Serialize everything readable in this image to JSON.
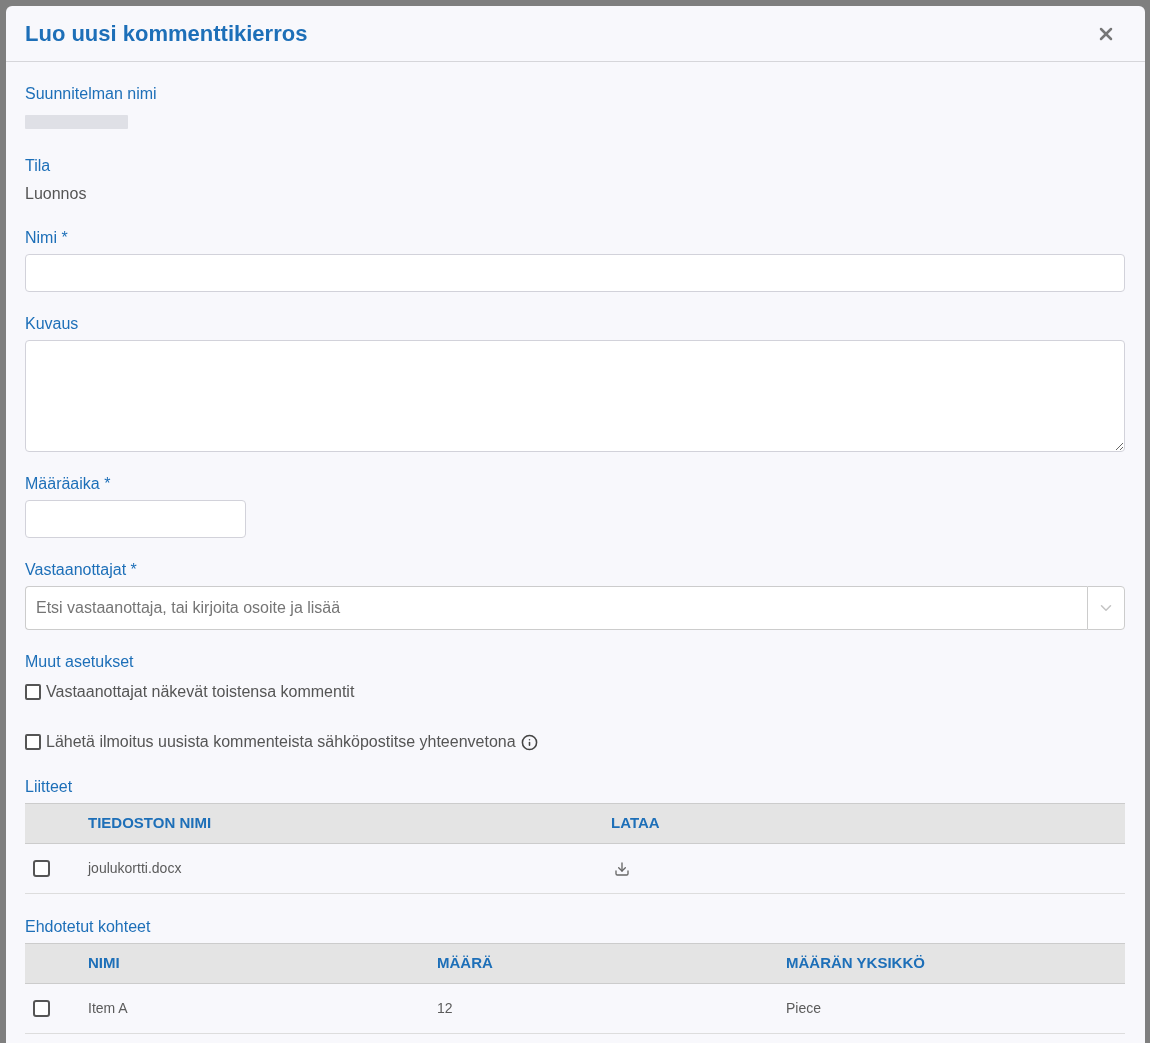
{
  "dialog": {
    "title": "Luo uusi kommenttikierros"
  },
  "plan": {
    "label": "Suunnitelman nimi"
  },
  "status": {
    "label": "Tila",
    "value": "Luonnos"
  },
  "fields": [
    {
      "kind": "text",
      "label": "Nimi *"
    },
    {
      "kind": "textarea",
      "label": "Kuvaus"
    },
    {
      "kind": "date",
      "label": "Määräaika *"
    },
    {
      "kind": "select",
      "label": "Vastaanottajat *",
      "placeholder": "Etsi vastaanottaja, tai kirjoita osoite ja lisää"
    }
  ],
  "options": {
    "title": "Muut asetukset",
    "items": [
      {
        "label": "Vastaanottajat näkevät toistensa kommentit",
        "checked": false,
        "info": false
      },
      {
        "label": "Lähetä ilmoitus uusista kommenteista sähköpostitse yhteenvetona",
        "checked": false,
        "info": true
      }
    ]
  },
  "attachments": {
    "title": "Liitteet",
    "columns": [
      "TIEDOSTON NIMI",
      "LATAA"
    ],
    "rows": [
      {
        "checked": false,
        "file_name": "joulukortti.docx"
      }
    ]
  },
  "suggested_items": {
    "title": "Ehdotetut kohteet",
    "columns": [
      "NIMI",
      "MÄÄRÄ",
      "MÄÄRÄN YKSIKKÖ"
    ],
    "rows": [
      {
        "checked": false,
        "cells": [
          "Item A",
          "12",
          "Piece"
        ]
      }
    ]
  }
}
